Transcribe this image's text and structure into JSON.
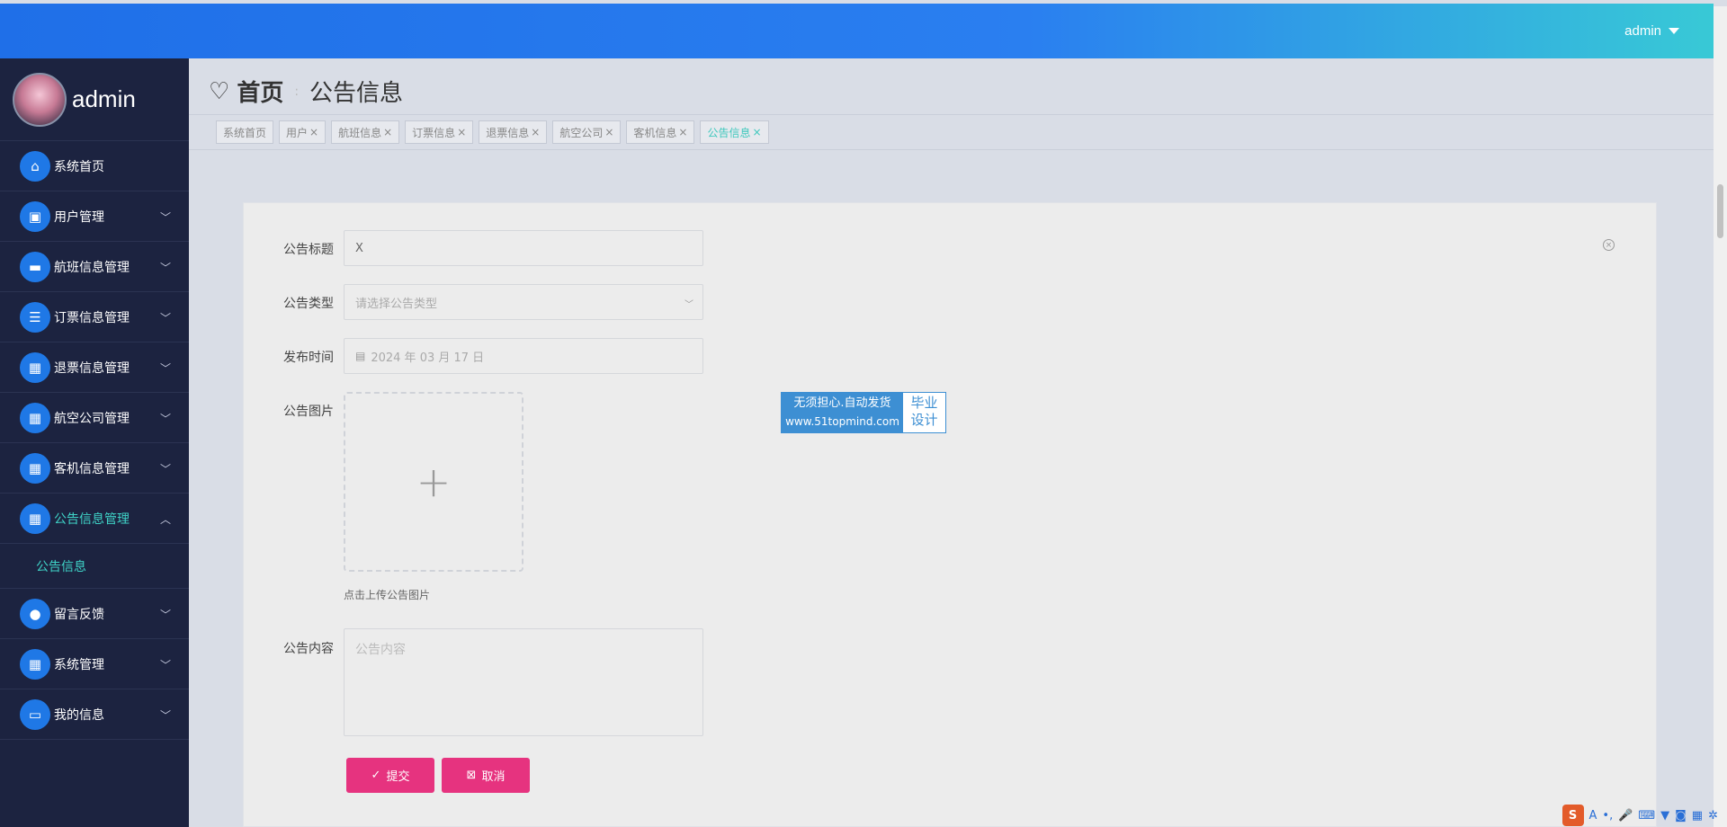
{
  "topbar": {
    "user_label": "admin"
  },
  "sidebar": {
    "profile_name": "admin",
    "items": [
      {
        "label": "系统首页",
        "icon": "home-icon",
        "glyph": "⌂"
      },
      {
        "label": "用户管理",
        "icon": "clipboard-icon",
        "glyph": "▣"
      },
      {
        "label": "航班信息管理",
        "icon": "ticket-icon",
        "glyph": "▬"
      },
      {
        "label": "订票信息管理",
        "icon": "list-icon",
        "glyph": "☰"
      },
      {
        "label": "退票信息管理",
        "icon": "grid-icon",
        "glyph": "▦"
      },
      {
        "label": "航空公司管理",
        "icon": "grid-icon",
        "glyph": "▦"
      },
      {
        "label": "客机信息管理",
        "icon": "grid-icon",
        "glyph": "▦"
      },
      {
        "label": "公告信息管理",
        "icon": "grid-icon",
        "glyph": "▦"
      },
      {
        "label": "留言反馈",
        "icon": "user-icon",
        "glyph": "●"
      },
      {
        "label": "系统管理",
        "icon": "grid-icon",
        "glyph": "▦"
      },
      {
        "label": "我的信息",
        "icon": "wallet-icon",
        "glyph": "▭"
      }
    ],
    "submenu": {
      "label": "公告信息"
    }
  },
  "breadcrumb": {
    "home": "首页",
    "separator": ":",
    "current": "公告信息"
  },
  "tags": [
    {
      "label": "系统首页",
      "closable": false
    },
    {
      "label": "用户",
      "closable": true
    },
    {
      "label": "航班信息",
      "closable": true
    },
    {
      "label": "订票信息",
      "closable": true
    },
    {
      "label": "退票信息",
      "closable": true
    },
    {
      "label": "航空公司",
      "closable": true
    },
    {
      "label": "客机信息",
      "closable": true
    },
    {
      "label": "公告信息",
      "closable": true
    }
  ],
  "form": {
    "title_label": "公告标题",
    "title_value": "X",
    "type_label": "公告类型",
    "type_placeholder": "请选择公告类型",
    "time_label": "发布时间",
    "time_value": "2024 年 03 月 17 日",
    "image_label": "公告图片",
    "upload_plus": "+",
    "upload_hint": "点击上传公告图片",
    "content_label": "公告内容",
    "content_placeholder": "公告内容",
    "submit_label": "提交",
    "cancel_label": "取消"
  },
  "watermark": {
    "line1": "无须担心.自动发货",
    "line2": "www.51topmind.com",
    "right1": "毕业",
    "right2": "设计"
  },
  "ime": {
    "brand": "S",
    "letter": "A"
  },
  "colors": {
    "accent": "#1f78e6",
    "sidebar_bg": "#1c2340",
    "active_text": "#3fd3c7",
    "button_pink": "#e6337f"
  }
}
